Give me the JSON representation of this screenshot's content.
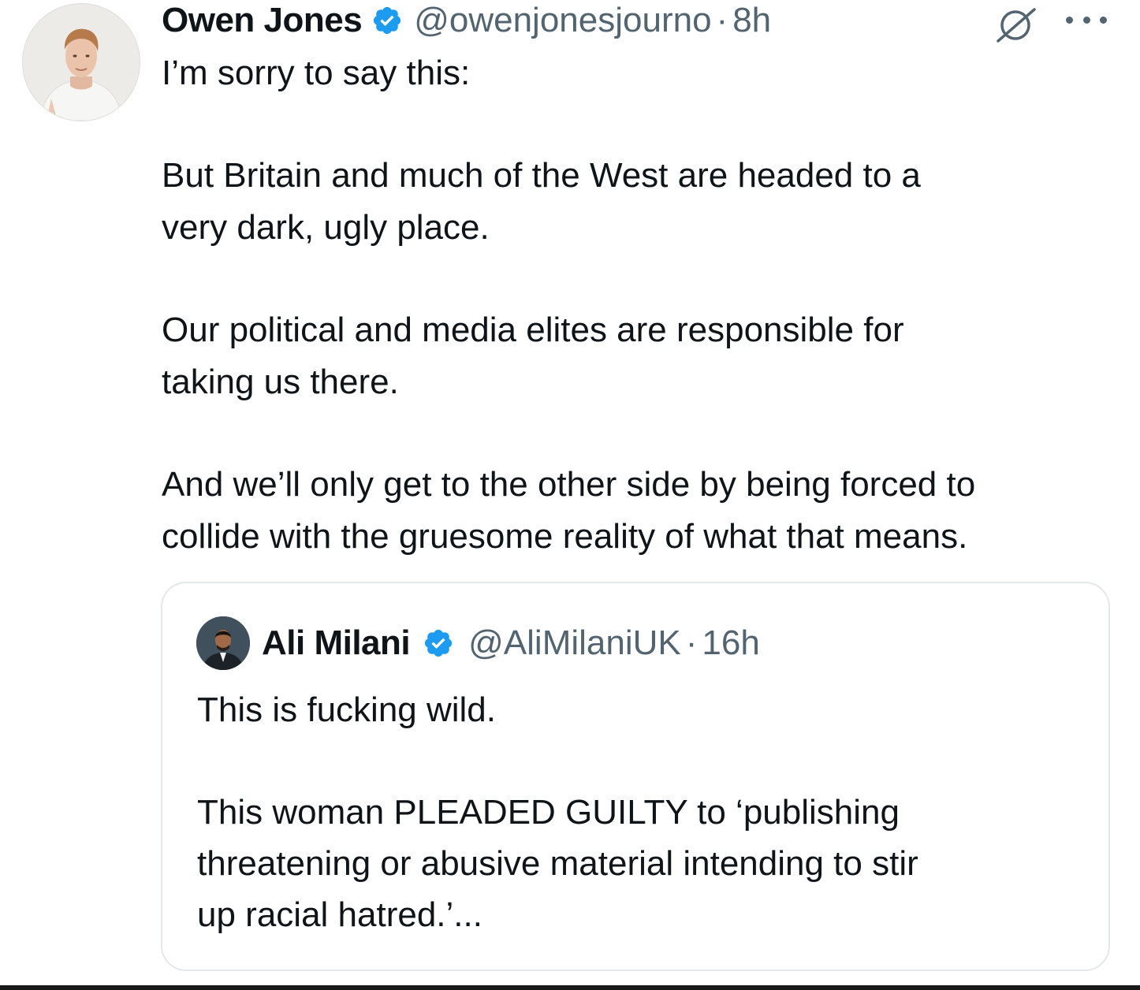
{
  "tweet": {
    "author": {
      "name": "Owen Jones",
      "handle": "@owenjonesjourno",
      "separator": "·",
      "time": "8h",
      "verified": true
    },
    "icons": [
      "grok-icon",
      "more-icon",
      "verified-badge-icon"
    ],
    "paragraphs": [
      "I’m sorry to say this:",
      "But Britain and much of the West are headed to a",
      "very dark, ugly place.",
      "Our political and media elites are responsible for",
      "taking us there.",
      "And we’ll only get to the other side by being forced to",
      "collide with the gruesome reality of what that means."
    ]
  },
  "quoted_tweet": {
    "author": {
      "name": "Ali Milani",
      "handle": "@AliMilaniUK",
      "separator": "·",
      "time": "16h",
      "verified": true
    },
    "paragraphs": [
      "This is fucking wild.",
      "This woman PLEADED GUILTY to ‘publishing",
      "threatening or abusive material intending to stir",
      "up racial hatred.’..."
    ]
  },
  "colors": {
    "text": "#0f1419",
    "secondary": "#536471",
    "verified_blue": "#1d9bf0",
    "border": "#e4e8eb"
  }
}
